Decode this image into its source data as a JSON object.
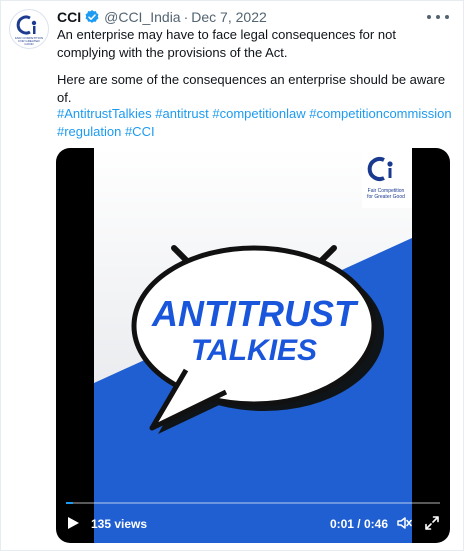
{
  "tweet": {
    "author_name": "CCI",
    "handle": "@CCI_India",
    "separator": "·",
    "date": "Dec 7, 2022",
    "line1": "An enterprise may have to face legal consequences for not complying with the provisions of the Act.",
    "line2": "Here are some of the consequences an enterprise should be aware of.",
    "hashtags": [
      "#AntitrustTalkies",
      "#antitrust",
      "#competitionlaw",
      "#competitioncommission",
      "#regulation",
      "#CCI"
    ]
  },
  "avatar": {
    "icon": "cci-logo-icon",
    "tiny_text": "FAIR COMPETITION FOR GREATER GOOD"
  },
  "icons": {
    "verified": "verified-badge-icon",
    "more": "more-options-icon",
    "play": "play-icon",
    "volume": "volume-icon",
    "fullscreen": "fullscreen-icon"
  },
  "video": {
    "poster": {
      "title_line1": "ANTITRUST",
      "title_line2": "TALKIES",
      "logo_tagline_line1": "Fair Competition",
      "logo_tagline_line2": "for Greater Good"
    },
    "views": "135 views",
    "time": "0:01 / 0:46",
    "progress": 0.02
  },
  "colors": {
    "link": "#1d9bf0",
    "brand_blue": "#1a56db",
    "poster_blue": "#1f5fd1",
    "text_secondary": "#536471"
  }
}
